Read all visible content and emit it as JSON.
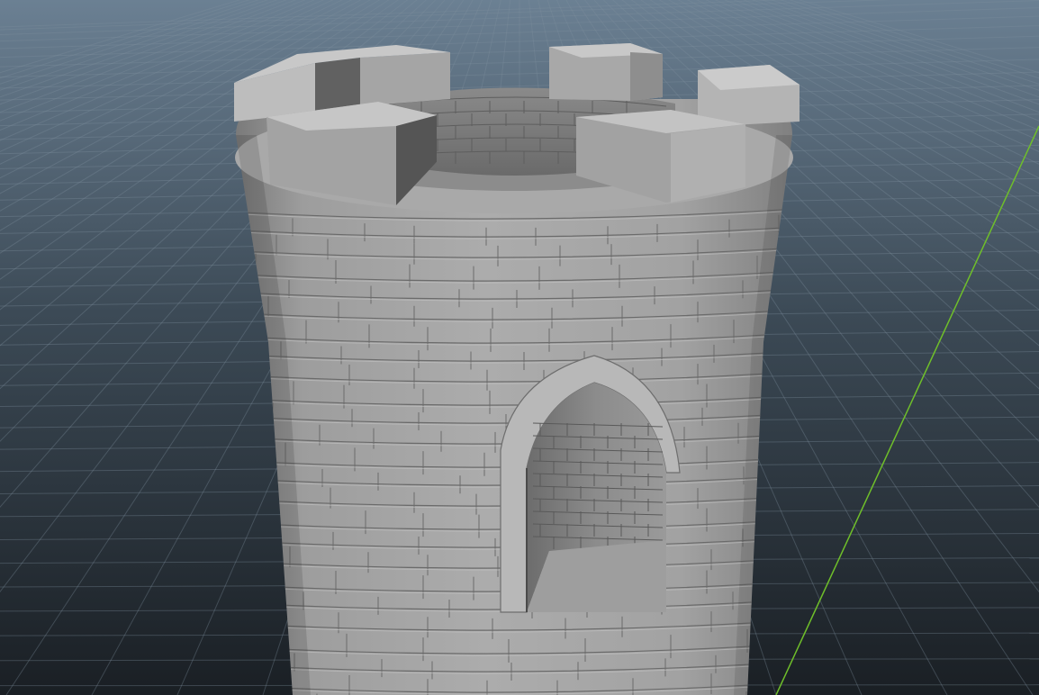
{
  "viewport": {
    "background_top": "#6a7f92",
    "background_bottom": "#1c2228",
    "grid_line_color": "#7d8f9e",
    "axis_line_color": "#6fbf2a"
  },
  "model": {
    "surface_color": "#a4a4a4",
    "shadow_color": "#5c5c5c",
    "highlight_color": "#c6c6c6",
    "merlon_count": 5
  }
}
